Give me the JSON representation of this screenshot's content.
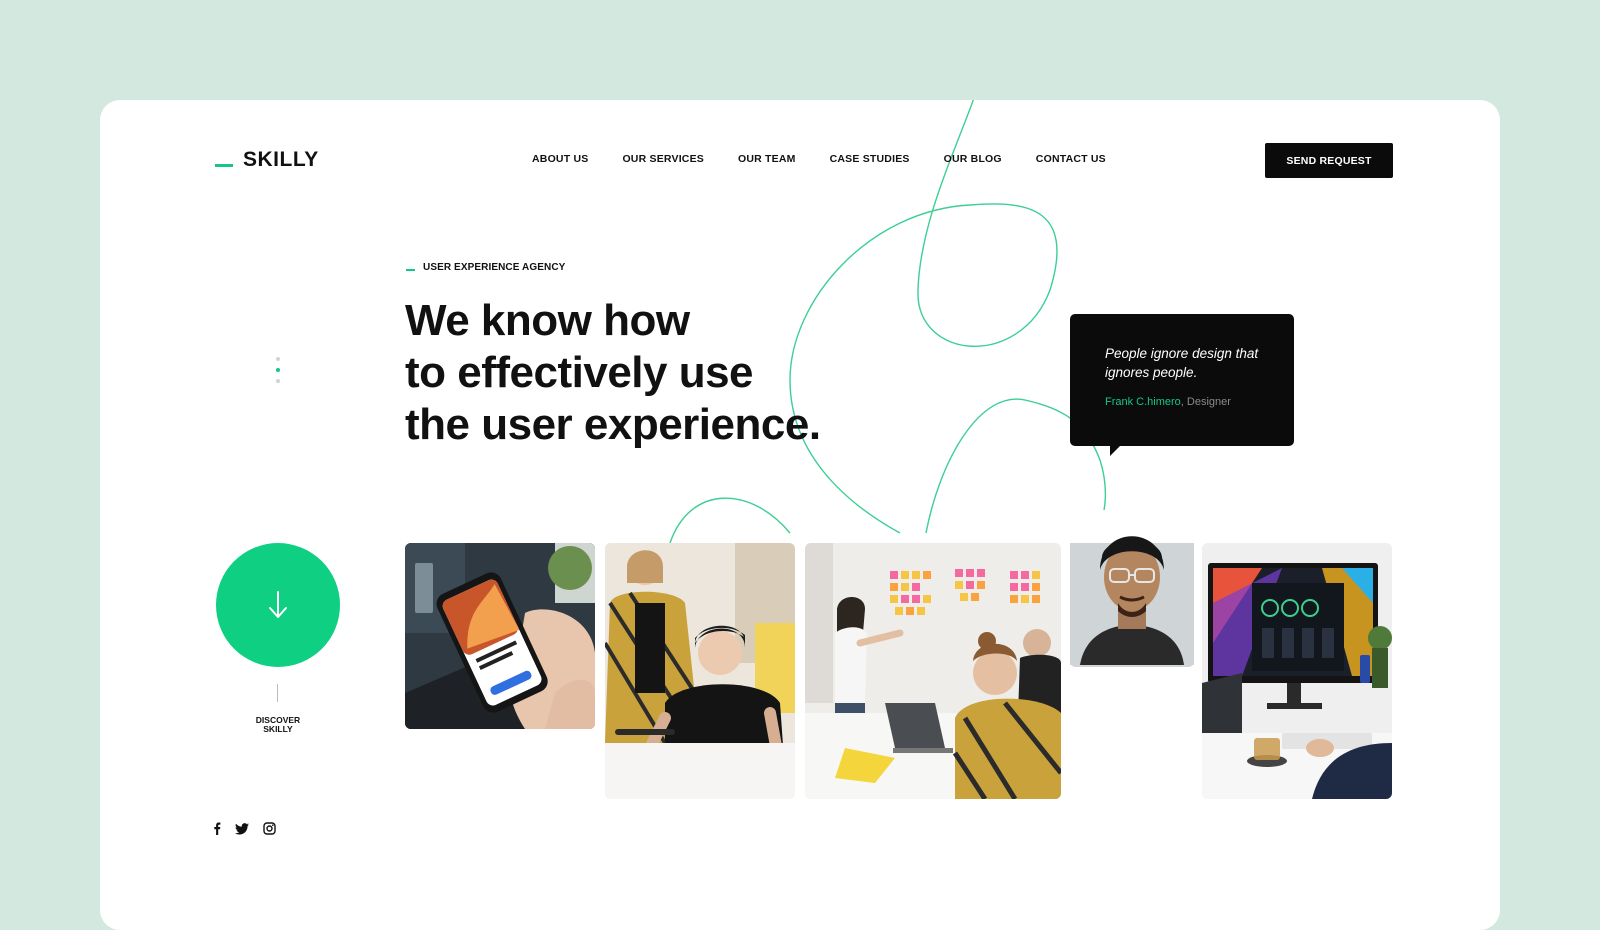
{
  "brand": {
    "name": "SKILLY",
    "accent": "#14c784",
    "bg": "#d3e8df"
  },
  "nav": {
    "items": [
      "ABOUT US",
      "OUR SERVICES",
      "OUR TEAM",
      "CASE STUDIES",
      "OUR BLOG",
      "CONTACT US"
    ]
  },
  "cta": {
    "label": "SEND REQUEST"
  },
  "hero": {
    "eyebrow": "USER EXPERIENCE AGENCY",
    "headline": [
      "We know how",
      "to effectively use",
      "the user experience."
    ]
  },
  "discover": {
    "line1": "DISCOVER",
    "line2": "SKILLY",
    "icon": "arrow-down-icon"
  },
  "slider": {
    "total": 3,
    "active": 1
  },
  "quote": {
    "text": "People ignore design that ignores people.",
    "author": "Frank C.himero",
    "separator": ", ",
    "role": "Designer"
  },
  "social": [
    "facebook-icon",
    "twitter-icon",
    "instagram-icon"
  ],
  "photos": [
    "phone-in-hand-photo",
    "designer-team-photo",
    "sticky-notes-meeting-photo",
    "designer-portrait-photo",
    "desk-monitor-photo"
  ]
}
